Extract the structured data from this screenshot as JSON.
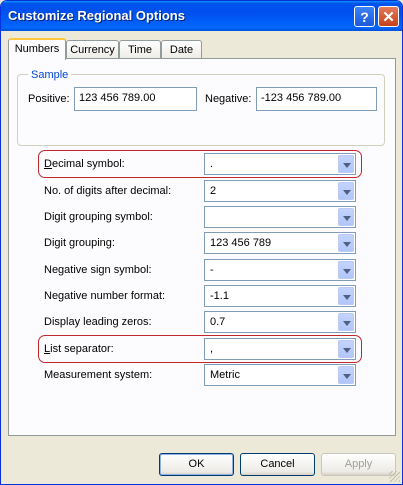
{
  "window": {
    "title": "Customize Regional Options",
    "help_label": "?",
    "close_label": "✕"
  },
  "tabs": [
    {
      "label": "Numbers",
      "active": true
    },
    {
      "label": "Currency",
      "active": false
    },
    {
      "label": "Time",
      "active": false
    },
    {
      "label": "Date",
      "active": false
    }
  ],
  "sample": {
    "group_label": "Sample",
    "positive_label": "Positive:",
    "positive_value": "123 456 789.00",
    "negative_label": "Negative:",
    "negative_value": "-123 456 789.00"
  },
  "settings": [
    {
      "label": "Decimal symbol:",
      "value": ".",
      "highlighted": true
    },
    {
      "label": "No. of digits after decimal:",
      "value": "2",
      "highlighted": false
    },
    {
      "label": "Digit grouping symbol:",
      "value": "",
      "highlighted": false
    },
    {
      "label": "Digit grouping:",
      "value": "123 456 789",
      "highlighted": false
    },
    {
      "label": "Negative sign symbol:",
      "value": "-",
      "highlighted": false
    },
    {
      "label": "Negative number format:",
      "value": "-1.1",
      "highlighted": false
    },
    {
      "label": "Display leading zeros:",
      "value": "0.7",
      "highlighted": false
    },
    {
      "label": "List separator:",
      "value": ",",
      "highlighted": true
    },
    {
      "label": "Measurement system:",
      "value": "Metric",
      "highlighted": false
    }
  ],
  "buttons": {
    "ok": "OK",
    "cancel": "Cancel",
    "apply": "Apply"
  },
  "colors": {
    "title_bar": "#0054e3",
    "highlight_outline": "#c0282b",
    "active_tab_accent": "#ffc83c"
  }
}
